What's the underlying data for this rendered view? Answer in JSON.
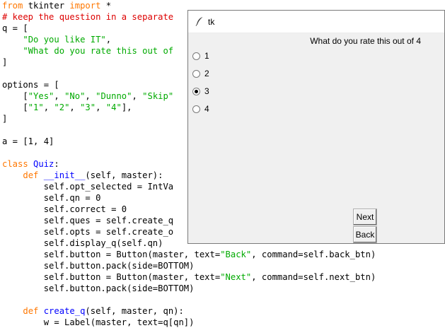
{
  "editor": {
    "lines": [
      [
        {
          "t": "from",
          "c": "kw"
        },
        {
          "t": " tkinter "
        },
        {
          "t": "import",
          "c": "kw"
        },
        {
          "t": " *"
        }
      ],
      [
        {
          "t": "# keep the question in a separate",
          "c": "cmt"
        }
      ],
      [
        {
          "t": "q = ["
        }
      ],
      [
        {
          "t": "    "
        },
        {
          "t": "\"Do you like IT\"",
          "c": "str"
        },
        {
          "t": ","
        }
      ],
      [
        {
          "t": "    "
        },
        {
          "t": "\"What do you rate this out of",
          "c": "str"
        }
      ],
      [
        {
          "t": "]"
        }
      ],
      [
        {
          "t": ""
        }
      ],
      [
        {
          "t": "options = ["
        }
      ],
      [
        {
          "t": "    ["
        },
        {
          "t": "\"Yes\"",
          "c": "str"
        },
        {
          "t": ", "
        },
        {
          "t": "\"No\"",
          "c": "str"
        },
        {
          "t": ", "
        },
        {
          "t": "\"Dunno\"",
          "c": "str"
        },
        {
          "t": ", "
        },
        {
          "t": "\"Skip\"",
          "c": "str"
        }
      ],
      [
        {
          "t": "    ["
        },
        {
          "t": "\"1\"",
          "c": "str"
        },
        {
          "t": ", "
        },
        {
          "t": "\"2\"",
          "c": "str"
        },
        {
          "t": ", "
        },
        {
          "t": "\"3\"",
          "c": "str"
        },
        {
          "t": ", "
        },
        {
          "t": "\"4\"",
          "c": "str"
        },
        {
          "t": "],"
        }
      ],
      [
        {
          "t": "]"
        }
      ],
      [
        {
          "t": ""
        }
      ],
      [
        {
          "t": "a = [1, 4]"
        }
      ],
      [
        {
          "t": ""
        }
      ],
      [
        {
          "t": "class",
          "c": "kw"
        },
        {
          "t": " "
        },
        {
          "t": "Quiz",
          "c": "def"
        },
        {
          "t": ":"
        }
      ],
      [
        {
          "t": "    "
        },
        {
          "t": "def",
          "c": "kw"
        },
        {
          "t": " "
        },
        {
          "t": "__init__",
          "c": "def"
        },
        {
          "t": "(self, master):"
        }
      ],
      [
        {
          "t": "        self.opt_selected = IntVa"
        }
      ],
      [
        {
          "t": "        self.qn = 0"
        }
      ],
      [
        {
          "t": "        self.correct = 0"
        }
      ],
      [
        {
          "t": "        self.ques = self.create_q"
        }
      ],
      [
        {
          "t": "        self.opts = self.create_o"
        }
      ],
      [
        {
          "t": "        self.display_q(self.qn)"
        }
      ],
      [
        {
          "t": "        self.button = Button(master, text="
        },
        {
          "t": "\"Back\"",
          "c": "str"
        },
        {
          "t": ", command=self.back_btn)"
        }
      ],
      [
        {
          "t": "        self.button.pack(side=BOTTOM)"
        }
      ],
      [
        {
          "t": "        self.button = Button(master, text="
        },
        {
          "t": "\"Next\"",
          "c": "str"
        },
        {
          "t": ", command=self.next_btn)"
        }
      ],
      [
        {
          "t": "        self.button.pack(side=BOTTOM)"
        }
      ],
      [
        {
          "t": ""
        }
      ],
      [
        {
          "t": "    "
        },
        {
          "t": "def",
          "c": "kw"
        },
        {
          "t": " "
        },
        {
          "t": "create_q",
          "c": "def"
        },
        {
          "t": "(self, master, qn):"
        }
      ],
      [
        {
          "t": "        w = Label(master, text=q[qn])"
        }
      ]
    ]
  },
  "window": {
    "title": "tk",
    "question": "What do you rate this out of 4",
    "options": [
      {
        "label": "1",
        "selected": false
      },
      {
        "label": "2",
        "selected": false
      },
      {
        "label": "3",
        "selected": true
      },
      {
        "label": "4",
        "selected": false
      }
    ],
    "next_label": "Next",
    "back_label": "Back"
  },
  "colors": {
    "keyword": "#ff7700",
    "comment": "#dd0000",
    "string": "#00aa00",
    "definition": "#0000ff"
  }
}
